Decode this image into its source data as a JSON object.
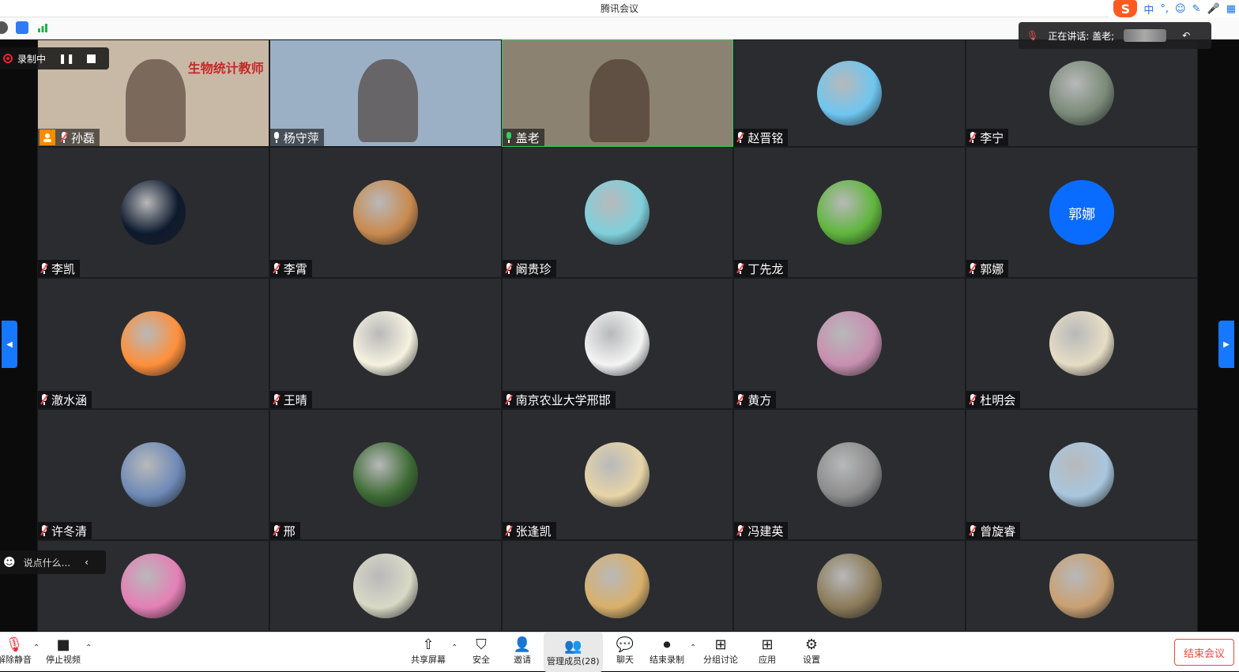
{
  "window": {
    "title": "腾讯会议"
  },
  "ime": {
    "mode": "中",
    "punct": "°,"
  },
  "recording": {
    "label": "录制中"
  },
  "speaking": {
    "text": "正在讲话: 盖老;"
  },
  "chat": {
    "placeholder": "说点什么..."
  },
  "participants": [
    {
      "name": "孙磊",
      "type": "video",
      "mic": "muted",
      "host": true,
      "bg": "#c8b9a6",
      "banner": "生物统计教师"
    },
    {
      "name": "杨守萍",
      "type": "video",
      "mic": "on",
      "bg": "#9bb0c4"
    },
    {
      "name": "盖老",
      "type": "video",
      "mic": "live",
      "bg": "#8c8271",
      "active": true
    },
    {
      "name": "赵晋铭",
      "type": "avatar",
      "mic": "muted",
      "color": "#6ec6f0"
    },
    {
      "name": "李宁",
      "type": "avatar",
      "mic": "muted",
      "color": "#7a8a78"
    },
    {
      "name": "李凯",
      "type": "avatar",
      "mic": "muted",
      "color": "#0d1a2e"
    },
    {
      "name": "李霄",
      "type": "avatar",
      "mic": "muted",
      "color": "#c98a4e"
    },
    {
      "name": "阚贵珍",
      "type": "avatar",
      "mic": "muted",
      "color": "#7fd0dc"
    },
    {
      "name": "丁先龙",
      "type": "avatar",
      "mic": "muted",
      "color": "#5fb53c"
    },
    {
      "name": "郭娜",
      "type": "text",
      "mic": "muted",
      "initials": "郭娜"
    },
    {
      "name": "澈水涵",
      "type": "avatar",
      "mic": "muted",
      "color": "#ff8f3a"
    },
    {
      "name": "王晴",
      "type": "avatar",
      "mic": "muted",
      "color": "#f6f2e0"
    },
    {
      "name": "南京农业大学邢邯",
      "type": "avatar",
      "mic": "muted",
      "color": "#f4f4f4"
    },
    {
      "name": "黄方",
      "type": "avatar",
      "mic": "muted",
      "color": "#c78fb0"
    },
    {
      "name": "杜明会",
      "type": "avatar",
      "mic": "muted",
      "color": "#e6ddc5"
    },
    {
      "name": "许冬清",
      "type": "avatar",
      "mic": "muted",
      "color": "#6e8ab7"
    },
    {
      "name": "邢",
      "type": "avatar",
      "mic": "muted",
      "color": "#3d6b34"
    },
    {
      "name": "张逢凯",
      "type": "avatar",
      "mic": "muted",
      "color": "#e7d4a8"
    },
    {
      "name": "冯建英",
      "type": "avatar",
      "mic": "muted",
      "color": "#8c8c8c"
    },
    {
      "name": "曾旋睿",
      "type": "avatar",
      "mic": "muted",
      "color": "#a9c6de"
    },
    {
      "name": "",
      "type": "avatar",
      "mic": "none",
      "color": "#e47fb5"
    },
    {
      "name": "",
      "type": "avatar",
      "mic": "none",
      "color": "#d9d9c6"
    },
    {
      "name": "",
      "type": "avatar",
      "mic": "none",
      "color": "#d9b06a"
    },
    {
      "name": "",
      "type": "avatar",
      "mic": "none",
      "color": "#8a7a58"
    },
    {
      "name": "",
      "type": "avatar",
      "mic": "none",
      "color": "#c9a071"
    }
  ],
  "toolbar": {
    "unmute": "解除静音",
    "stop_video": "停止视频",
    "share": "共享屏幕",
    "security": "安全",
    "invite": "邀请",
    "members": "管理成员(28)",
    "chat": "聊天",
    "end_record": "结束录制",
    "breakout": "分组讨论",
    "apps": "应用",
    "settings": "设置",
    "end_meeting": "结束会议"
  }
}
